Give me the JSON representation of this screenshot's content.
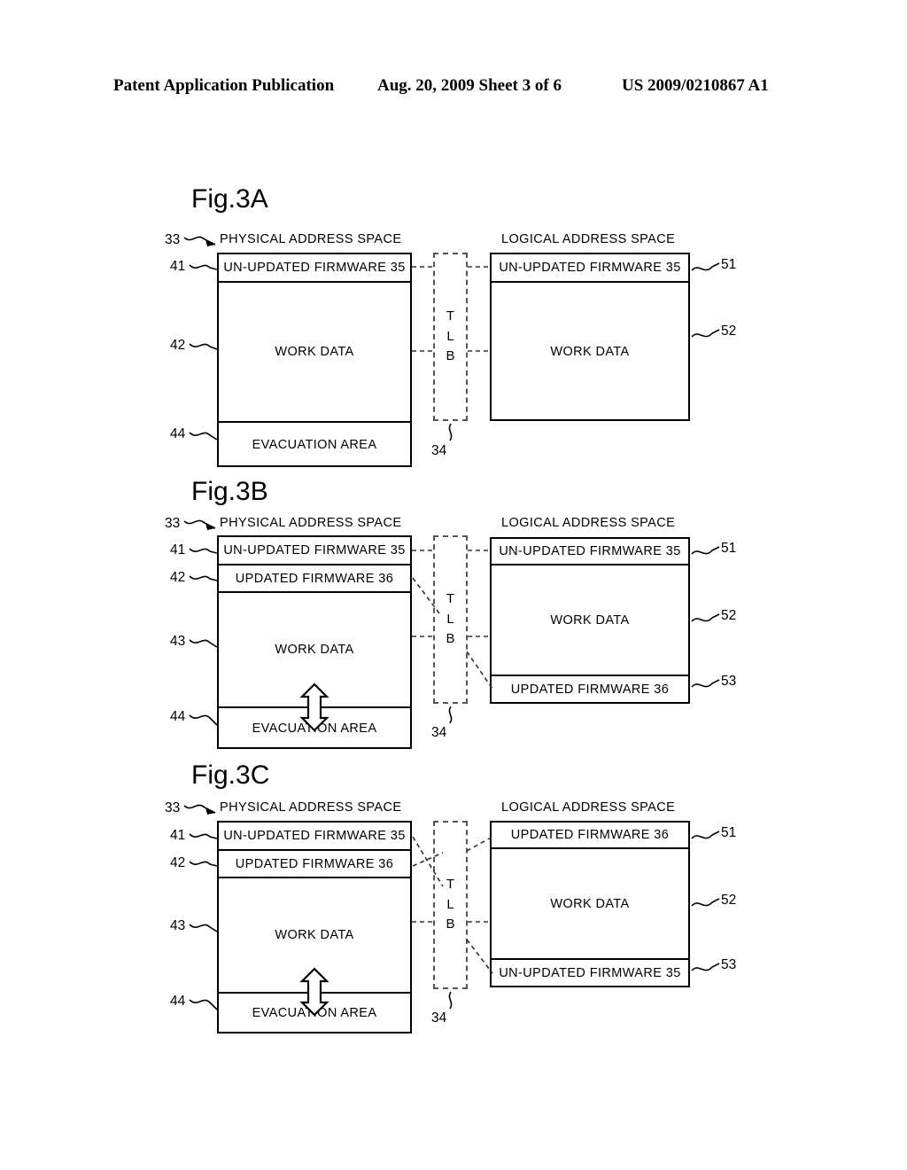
{
  "header": {
    "publication": "Patent Application Publication",
    "date_sheet": "Aug. 20, 2009  Sheet 3 of 6",
    "patent_number": "US 2009/0210867 A1"
  },
  "common": {
    "physical_label": "PHYSICAL ADDRESS SPACE",
    "logical_label": "LOGICAL ADDRESS SPACE",
    "tlb_letters": [
      "T",
      "L",
      "B"
    ],
    "tlb_ref": "34",
    "physical_ref": "33"
  },
  "figures": [
    {
      "title": "Fig.3A",
      "physical": {
        "rows": [
          {
            "label": "UN-UPDATED FIRMWARE 35",
            "ref": "41"
          },
          {
            "label": "WORK DATA",
            "ref": "42"
          },
          {
            "label": "EVACUATION AREA",
            "ref": "44"
          }
        ]
      },
      "logical": {
        "rows": [
          {
            "label": "UN-UPDATED FIRMWARE 35",
            "ref": "51"
          },
          {
            "label": "WORK DATA",
            "ref": "52"
          }
        ]
      },
      "has_swap_arrow": false
    },
    {
      "title": "Fig.3B",
      "physical": {
        "rows": [
          {
            "label": "UN-UPDATED FIRMWARE 35",
            "ref": "41"
          },
          {
            "label": "UPDATED FIRMWARE 36",
            "ref": "42"
          },
          {
            "label": "WORK DATA",
            "ref": "43"
          },
          {
            "label": "EVACUATION AREA",
            "ref": "44"
          }
        ]
      },
      "logical": {
        "rows": [
          {
            "label": "UN-UPDATED FIRMWARE 35",
            "ref": "51"
          },
          {
            "label": "WORK DATA",
            "ref": "52"
          },
          {
            "label": "UPDATED FIRMWARE 36",
            "ref": "53"
          }
        ]
      },
      "has_swap_arrow": true
    },
    {
      "title": "Fig.3C",
      "physical": {
        "rows": [
          {
            "label": "UN-UPDATED FIRMWARE 35",
            "ref": "41"
          },
          {
            "label": "UPDATED FIRMWARE 36",
            "ref": "42"
          },
          {
            "label": "WORK DATA",
            "ref": "43"
          },
          {
            "label": "EVACUATION AREA",
            "ref": "44"
          }
        ]
      },
      "logical": {
        "rows": [
          {
            "label": "UPDATED FIRMWARE 36",
            "ref": "51"
          },
          {
            "label": "WORK DATA",
            "ref": "52"
          },
          {
            "label": "UN-UPDATED FIRMWARE 35",
            "ref": "53"
          }
        ]
      },
      "has_swap_arrow": true
    }
  ]
}
